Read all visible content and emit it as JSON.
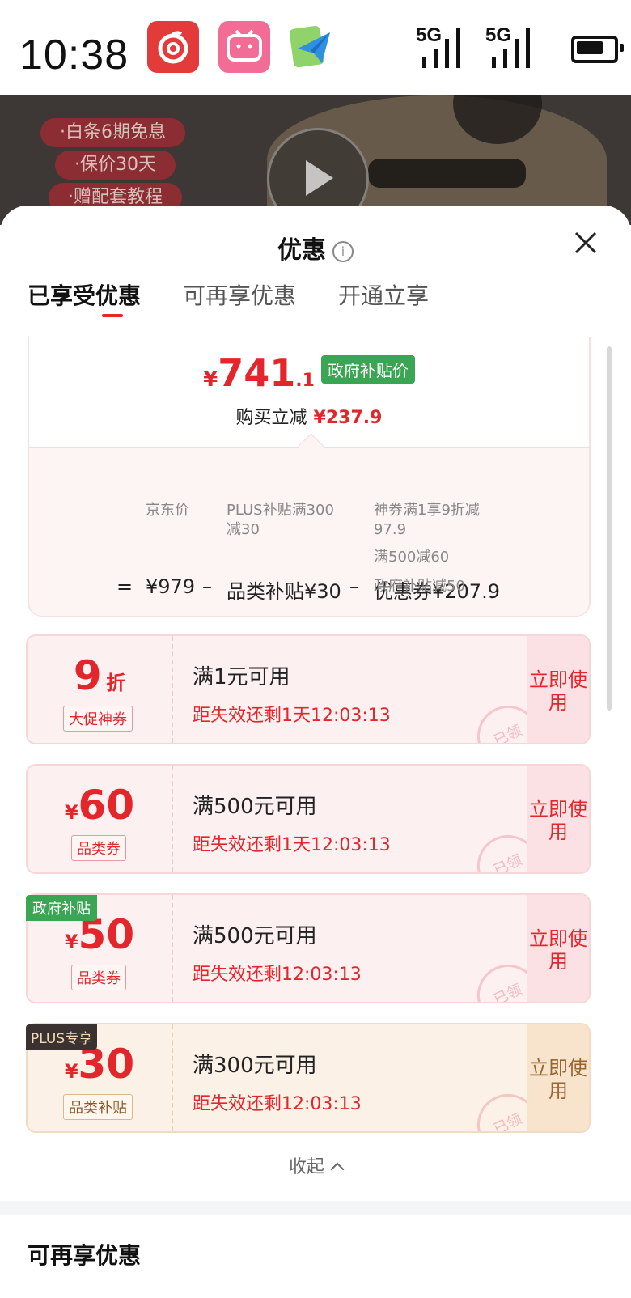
{
  "status_bar": {
    "time": "10:38",
    "signal_1": "5G",
    "signal_2": "5G",
    "apps": [
      "netease-music-icon",
      "bilibili-icon",
      "telegram-icon"
    ]
  },
  "background": {
    "promos": [
      "·白条6期免息",
      "·保价30天",
      "·赠配套教程"
    ]
  },
  "sheet": {
    "title": "优惠",
    "tabs": [
      "已享受优惠",
      "可再享优惠",
      "开通立享"
    ]
  },
  "summary": {
    "yen": "¥",
    "price_int": "741",
    "price_dec": ".1",
    "badge": "政府补贴价",
    "reduce_label": "购买立减",
    "reduce_amount": "¥237.9",
    "eq": "=",
    "jd_price": "¥979",
    "jd_label": "京东价",
    "minus": "–",
    "cat_sub": "品类补贴¥30",
    "cat_note": "PLUS补贴满300减30",
    "coupon_sub": "优惠券¥207.9",
    "coupon_notes": [
      "神券满1享9折减97.9",
      "满500减60",
      "政府补贴减50"
    ]
  },
  "coupons": [
    {
      "amount": "9",
      "unit": "折",
      "type": "大促神券",
      "cond": "满1元可用",
      "expire": "距失效还剩1天12:03:13",
      "use": "立即使用",
      "stamp": "已领"
    },
    {
      "amount": "60",
      "unit": "¥",
      "type": "品类券",
      "cond": "满500元可用",
      "expire": "距失效还剩1天12:03:13",
      "use": "立即使用",
      "stamp": "已领"
    },
    {
      "amount": "50",
      "unit": "¥",
      "type": "品类券",
      "cond": "满500元可用",
      "expire": "距失效还剩12:03:13",
      "use": "立即使用",
      "stamp": "已领",
      "tag": "政府补贴"
    },
    {
      "amount": "30",
      "unit": "¥",
      "type": "品类补贴",
      "cond": "满300元可用",
      "expire": "距失效还剩12:03:13",
      "use": "立即使用",
      "stamp": "已领",
      "tag": "PLUS专享"
    }
  ],
  "collapse_label": "收起",
  "next_section_title": "可再享优惠",
  "colors": {
    "accent": "#e3262b",
    "gov_green": "#3aa552"
  }
}
